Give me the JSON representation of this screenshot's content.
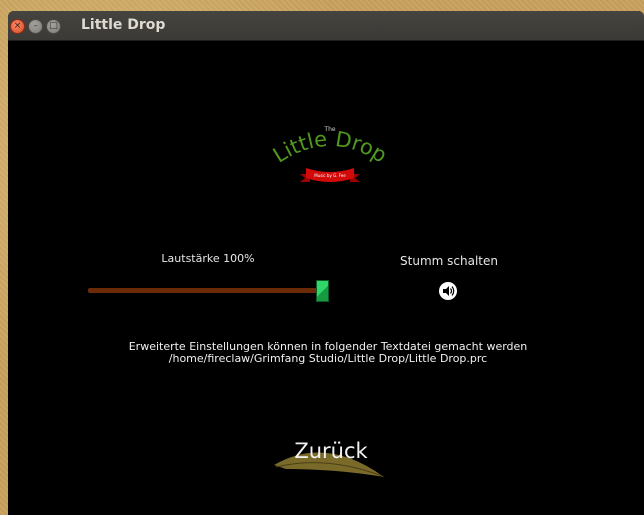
{
  "window": {
    "title": "Little Drop",
    "controls": [
      "close-icon",
      "minimize-icon",
      "maximize-icon"
    ]
  },
  "logo": {
    "small_text": "The",
    "name": "Little Drop",
    "ribbon_text": "Music by G. Fee"
  },
  "volume": {
    "label": "Lautstärke 100%",
    "value_percent": 100,
    "track_color": "#6b2b08",
    "thumb_color": "#2fd66a"
  },
  "mute": {
    "label": "Stumm schalten",
    "icon": "speaker-icon",
    "muted": false
  },
  "info": {
    "line1": "Erweiterte Einstellungen können in folgender Textdatei gemacht werden",
    "line2": "/home/fireclaw/Grimfang Studio/Little Drop/Little Drop.prc"
  },
  "back_button": {
    "label": "Zurück",
    "leaf_color": "#7a6a2a"
  }
}
